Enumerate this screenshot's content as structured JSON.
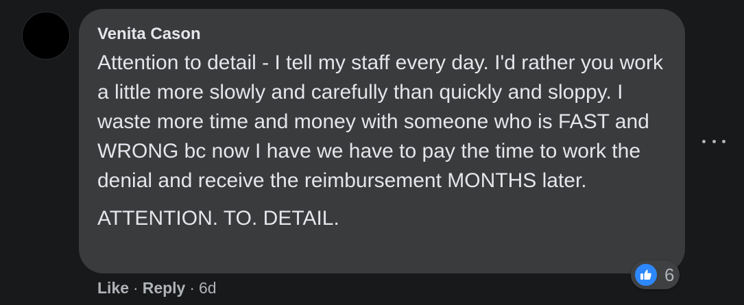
{
  "comment": {
    "author": "Venita Cason",
    "paragraphs": [
      "Attention to detail - I tell my staff every day. I'd rather you work a little more slowly and carefully than quickly and sloppy. I waste more time and money with someone who is FAST and WRONG bc now I have we have to pay the time to work the denial and receive the reimbursement MONTHS later.",
      "ATTENTION. TO. DETAIL."
    ],
    "reaction_icon": "thumbs-up-icon",
    "reaction_count": "6",
    "more_icon": "ellipsis-icon"
  },
  "actions": {
    "like_label": "Like",
    "separator": "·",
    "reply_label": "Reply",
    "timestamp": "6d"
  },
  "colors": {
    "background": "#18191a",
    "bubble": "#3a3b3c",
    "text": "#e4e6eb",
    "secondary_text": "#b0b3b8",
    "like_blue": "#2d88ff"
  }
}
